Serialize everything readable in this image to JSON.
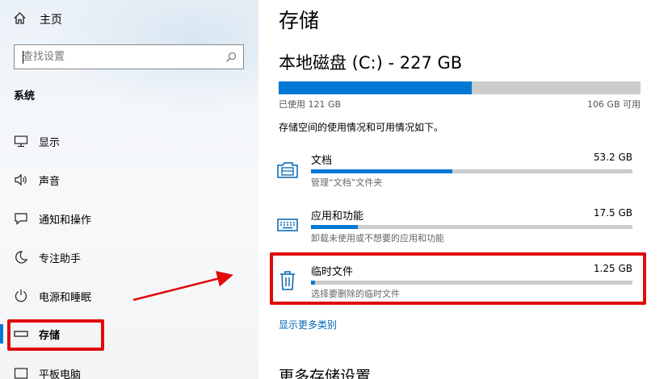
{
  "sidebar": {
    "home_label": "主页",
    "search_placeholder": "查找设置",
    "section_title": "系统",
    "items": [
      {
        "label": "显示",
        "icon": "monitor-icon"
      },
      {
        "label": "声音",
        "icon": "speaker-icon"
      },
      {
        "label": "通知和操作",
        "icon": "notification-icon"
      },
      {
        "label": "专注助手",
        "icon": "moon-icon"
      },
      {
        "label": "电源和睡眠",
        "icon": "power-icon"
      },
      {
        "label": "存储",
        "icon": "storage-drive-icon",
        "active": true
      },
      {
        "label": "平板电脑",
        "icon": "tablet-icon"
      }
    ]
  },
  "main": {
    "page_title": "存储",
    "drive": {
      "title": "本地磁盘 (C:) - 227 GB",
      "used_label": "已使用 121 GB",
      "free_label": "106 GB 可用",
      "used_fraction": 0.533
    },
    "description": "存储空间的使用情况和可用情况如下。",
    "categories": [
      {
        "name": "文档",
        "size": "53.2 GB",
        "subtitle": "管理“文档”文件夹",
        "fraction": 0.44,
        "icon": "documents-folder-icon"
      },
      {
        "name": "应用和功能",
        "size": "17.5 GB",
        "subtitle": "卸载未使用或不想要的应用和功能",
        "fraction": 0.145,
        "icon": "keyboard-icon"
      },
      {
        "name": "临时文件",
        "size": "1.25 GB",
        "subtitle": "选择要删除的临时文件",
        "fraction": 0.012,
        "icon": "trash-icon"
      }
    ],
    "more_categories_link": "显示更多类别",
    "more_settings_heading": "更多存储设置"
  },
  "annotations": {
    "highlight_color": "#e00b0b",
    "accent_color": "#0078d4"
  }
}
